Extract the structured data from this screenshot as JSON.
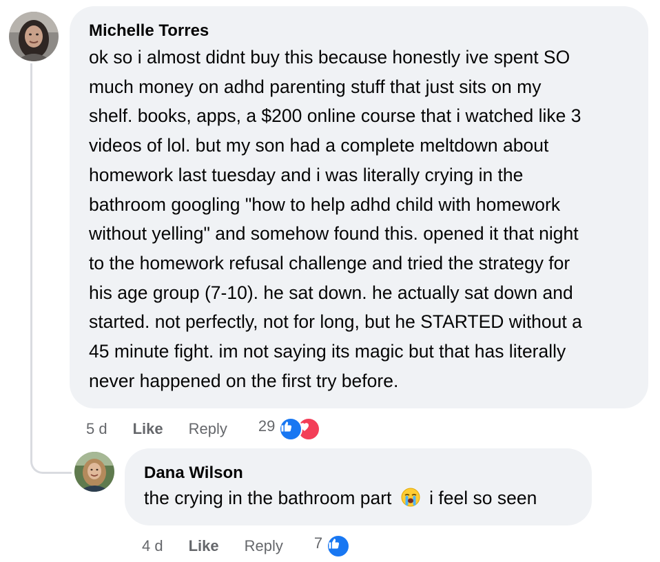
{
  "comment1": {
    "author": "Michelle Torres",
    "lines": [
      "ok so i almost didnt buy this because honestly ive spent SO",
      "much money on adhd parenting stuff that just sits on my",
      "shelf. books, apps, a $200 online course that i watched like 3",
      "videos of lol. but my son had a complete meltdown about",
      "homework last tuesday and i was literally crying in the",
      "bathroom googling \"how to help adhd child with homework",
      "without yelling\" and somehow found this. opened it that night",
      "to the homework refusal challenge and tried the strategy for",
      "his age group (7-10). he sat down. he actually sat down and",
      "started. not perfectly, not for long, but he STARTED without a",
      "45 minute fight. im not saying its magic but that has literally",
      "never happened on the first try before."
    ],
    "time": "5 d",
    "like_label": "Like",
    "reply_label": "Reply",
    "reaction_count": "29"
  },
  "comment2": {
    "author": "Dana Wilson",
    "text_before": "the crying in the bathroom part",
    "text_after": "i feel so seen",
    "time": "4 d",
    "like_label": "Like",
    "reply_label": "Reply",
    "reaction_count": "7"
  },
  "colors": {
    "bubble": "#f0f2f5",
    "meta_text": "#65676b",
    "like_blue": "#1877f2",
    "love_red": "#f33e58"
  },
  "icons": {
    "like": "thumbs-up-icon",
    "love": "heart-icon",
    "emoji": "loudly-crying-face-emoji"
  }
}
